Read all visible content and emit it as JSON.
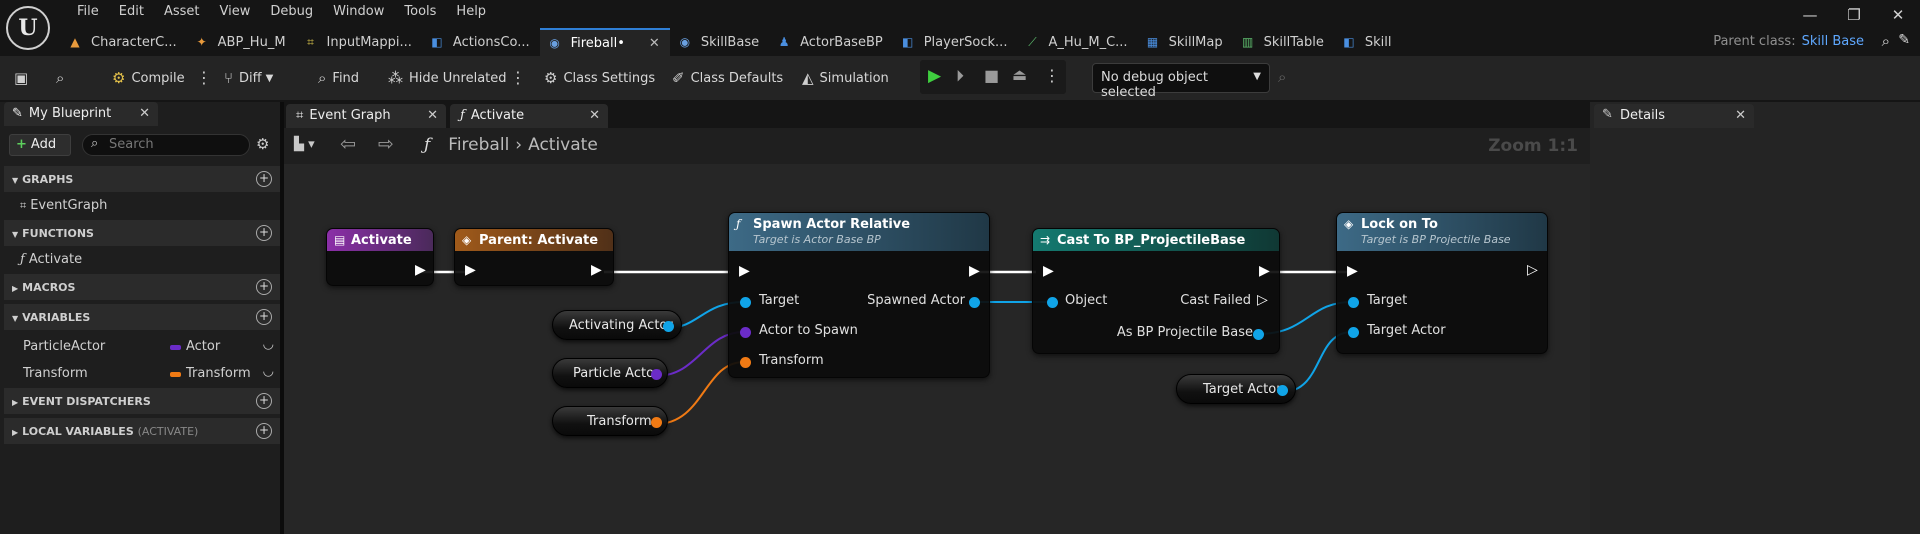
{
  "menu": [
    "File",
    "Edit",
    "Asset",
    "View",
    "Debug",
    "Window",
    "Tools",
    "Help"
  ],
  "doc_tabs": [
    {
      "label": "CharacterC...",
      "icon": "▲",
      "color": "#e89a3c"
    },
    {
      "label": "ABP_Hu_M",
      "icon": "✦",
      "color": "#e89a3c"
    },
    {
      "label": "InputMappi...",
      "icon": "⌗",
      "color": "#d4c04a"
    },
    {
      "label": "ActionsCo...",
      "icon": "◧",
      "color": "#4a8fe0"
    },
    {
      "label": "Fireball•",
      "icon": "◉",
      "color": "#6aa0e0"
    },
    {
      "label": "SkillBase",
      "icon": "◉",
      "color": "#6aa0e0"
    },
    {
      "label": "ActorBaseBP",
      "icon": "♟",
      "color": "#4a8fe0"
    },
    {
      "label": "PlayerSock...",
      "icon": "◧",
      "color": "#4a8fe0"
    },
    {
      "label": "A_Hu_M_C...",
      "icon": "⟋",
      "color": "#5fbf6f"
    },
    {
      "label": "SkillMap",
      "icon": "▦",
      "color": "#4a8fe0"
    },
    {
      "label": "SkillTable",
      "icon": "▥",
      "color": "#5fbf6f"
    },
    {
      "label": "Skill",
      "icon": "◧",
      "color": "#4a8fe0"
    }
  ],
  "parent_class": {
    "label": "Parent class:",
    "value": "Skill Base"
  },
  "toolbar": {
    "compile": "Compile",
    "diff": "Diff",
    "find": "Find",
    "hide_unrelated": "Hide Unrelated",
    "class_settings": "Class Settings",
    "class_defaults": "Class Defaults",
    "simulation": "Simulation",
    "debug_object": "No debug object selected"
  },
  "my_blueprint": {
    "tab": "My Blueprint",
    "add": "Add",
    "search_placeholder": "Search",
    "sections": {
      "graphs": "GRAPHS",
      "functions": "FUNCTIONS",
      "macros": "MACROS",
      "variables": "VARIABLES",
      "event_dispatchers": "EVENT DISPATCHERS",
      "local_variables": "LOCAL VARIABLES",
      "local_variables_sub": "(ACTIVATE)"
    },
    "graph_items": [
      "EventGraph"
    ],
    "function_items": [
      "Activate"
    ],
    "variables": [
      {
        "name": "ParticleActor",
        "type": "Actor",
        "color": "#6b2cc8"
      },
      {
        "name": "Transform",
        "type": "Transform",
        "color": "#f07a14"
      }
    ]
  },
  "graph_tabs": [
    "Event Graph",
    "Activate"
  ],
  "breadcrumb": {
    "root": "Fireball",
    "current": "Activate"
  },
  "zoom": "Zoom 1:1",
  "nodes": {
    "activate": {
      "title": "Activate"
    },
    "parent_activate": {
      "title": "Parent: Activate"
    },
    "spawn": {
      "title": "Spawn Actor Relative",
      "subtitle": "Target is Actor Base BP",
      "pins_in": [
        "Target",
        "Actor to Spawn",
        "Transform"
      ],
      "pin_out": "Spawned Actor"
    },
    "cast": {
      "title": "Cast To BP_ProjectileBase",
      "pin_in": "Object",
      "cast_failed": "Cast Failed",
      "pin_out": "As BP Projectile Base"
    },
    "lockon": {
      "title": "Lock on To",
      "subtitle": "Target is BP Projectile Base",
      "pins_in": [
        "Target",
        "Target Actor"
      ]
    }
  },
  "var_nodes": [
    "Activating Actor",
    "Particle Actor",
    "Transform",
    "Target Actor"
  ],
  "details": {
    "tab": "Details"
  },
  "colors": {
    "accent": "#2f7fd6",
    "object_pin": "#10a4e8",
    "actor_pin": "#6b2cc8",
    "transform_pin": "#f07a14",
    "exec": "#ffffff"
  }
}
